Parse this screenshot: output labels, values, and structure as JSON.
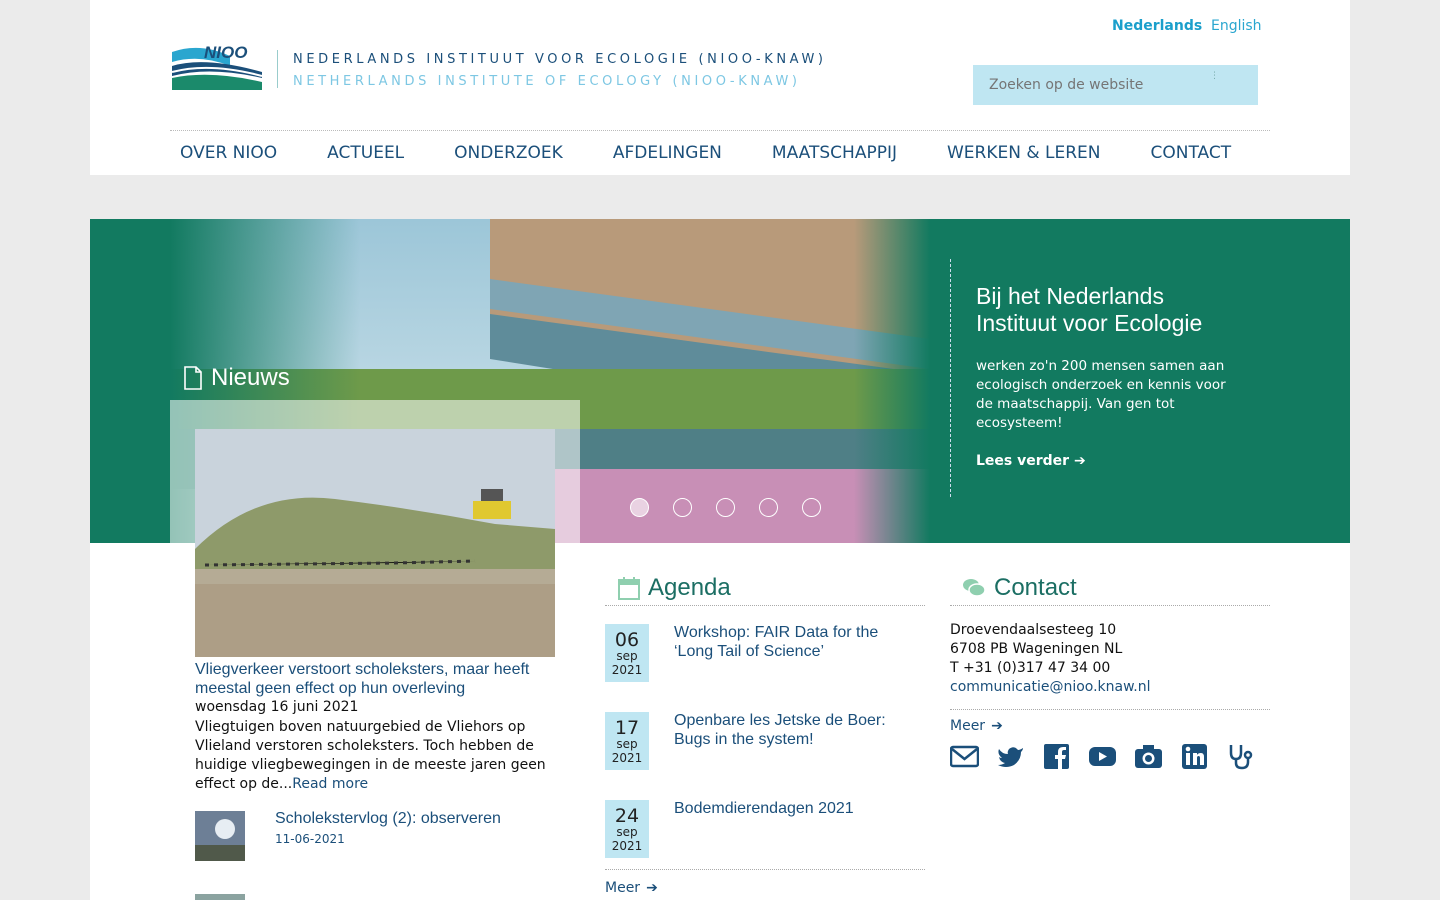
{
  "languages": [
    {
      "label": "Nederlands",
      "active": true
    },
    {
      "label": "English",
      "active": false
    }
  ],
  "institute": {
    "name_nl": "NEDERLANDS INSTITUUT VOOR ECOLOGIE (NIOO-KNAW)",
    "name_en": "NETHERLANDS INSTITUTE OF ECOLOGY (NIOO-KNAW)",
    "logo_text": "NIOO"
  },
  "search": {
    "placeholder": "Zoeken op de website",
    "dots": "⋮"
  },
  "nav": [
    "OVER NIOO",
    "ACTUEEL",
    "ONDERZOEK",
    "AFDELINGEN",
    "MAATSCHAPPIJ",
    "WERKEN & LEREN",
    "CONTACT"
  ],
  "hero": {
    "title": "Bij het Nederlands Instituut voor Ecologie",
    "body": "werken zo'n 200 mensen samen aan ecologisch onderzoek en kennis voor de maatschappij. Van gen tot ecosysteem!",
    "link": "Lees verder",
    "slide_count": 5,
    "active_slide": 1
  },
  "news": {
    "label": "Nieuws",
    "main": {
      "title": "Vliegverkeer verstoort scholeksters, maar heeft meestal geen effect op hun overleving",
      "date": "woensdag 16 juni 2021",
      "body": "Vliegtuigen boven natuurgebied de Vliehors op Vlieland verstoren scholeksters. Toch hebben de huidige vliegbewegingen in de meeste jaren geen effect op de...",
      "read_more": "Read more"
    },
    "items": [
      {
        "title": "Scholekstervlog (2): observeren",
        "date": "11-06-2021"
      }
    ]
  },
  "agenda": {
    "label": "Agenda",
    "items": [
      {
        "day": "06",
        "month": "sep",
        "year": "2021",
        "title": "Workshop: FAIR Data for the ‘Long Tail of Science’"
      },
      {
        "day": "17",
        "month": "sep",
        "year": "2021",
        "title": "Openbare les Jetske de Boer: Bugs in the system!"
      },
      {
        "day": "24",
        "month": "sep",
        "year": "2021",
        "title": "Bodemdierendagen 2021"
      }
    ],
    "more": "Meer"
  },
  "contact": {
    "label": "Contact",
    "address1": "Droevendaalsesteeg 10",
    "address2": "6708 PB Wageningen NL",
    "phone": "T +31 (0)317 47 34 00",
    "email": "communicatie@nioo.knaw.nl",
    "more": "Meer",
    "social_icons": [
      "mail-icon",
      "twitter-icon",
      "facebook-icon",
      "youtube-icon",
      "camera-icon",
      "linkedin-icon",
      "stethoscope-icon"
    ]
  },
  "colors": {
    "brand_dark": "#1b4f7a",
    "hero_green": "#127a60",
    "accent_light": "#bfe6f2",
    "lang_blue": "#1b9fcb"
  }
}
